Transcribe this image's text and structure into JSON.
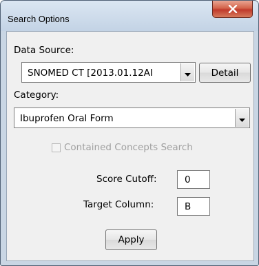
{
  "window": {
    "title": "Search Options"
  },
  "data_source": {
    "label": "Data Source:",
    "selected": "SNOMED CT [2013.01.12AI",
    "detail_button": "Detail"
  },
  "category": {
    "label": "Category:",
    "selected": "Ibuprofen Oral Form"
  },
  "contained_search": {
    "label": "Contained Concepts Search",
    "checked": false,
    "enabled": false
  },
  "score_cutoff": {
    "label": "Score Cutoff:",
    "value": "0"
  },
  "target_column": {
    "label": "Target Column:",
    "value": "B"
  },
  "apply_button": "Apply",
  "icons": {
    "close": "close-icon",
    "dropdown": "dropdown-arrow-icon"
  }
}
